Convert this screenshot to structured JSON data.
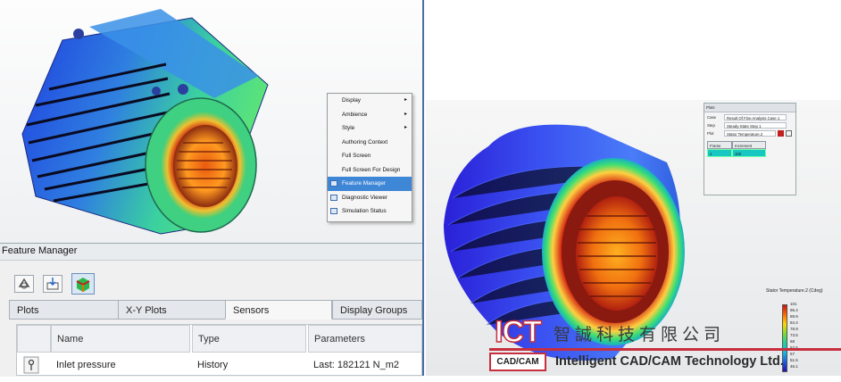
{
  "context_menu": {
    "items": [
      {
        "label": "Display",
        "submenu": true
      },
      {
        "label": "Ambience",
        "submenu": true
      },
      {
        "label": "Style",
        "submenu": true
      },
      {
        "label": "Authoring Context",
        "submenu": false
      },
      {
        "label": "Full Screen",
        "submenu": false
      },
      {
        "label": "Full Screen For Design",
        "submenu": false
      },
      {
        "label": "Feature Manager",
        "submenu": false,
        "selected": true
      },
      {
        "label": "Diagnostic Viewer",
        "submenu": false
      },
      {
        "label": "Simulation Status",
        "submenu": false
      }
    ],
    "submenu_arrow": "▸"
  },
  "feature_manager": {
    "title": "Feature Manager",
    "tabs": [
      {
        "label": "Plots"
      },
      {
        "label": "X-Y Plots"
      },
      {
        "label": "Sensors",
        "active": true
      },
      {
        "label": "Display Groups"
      }
    ],
    "columns": [
      "Name",
      "Type",
      "Parameters"
    ],
    "rows": [
      {
        "name": "Inlet pressure",
        "type": "History",
        "parameters": "Last: 182121 N_m2"
      }
    ]
  },
  "plots_dialog": {
    "title": "Plots",
    "fields": [
      {
        "label": "Case",
        "value": "Result Of Fine Analysis Case 1"
      },
      {
        "label": "Step",
        "value": "Steady-State Step 1"
      },
      {
        "label": "Plot",
        "value": "Stator Temperature.2"
      }
    ],
    "table_headers": [
      "Frame",
      "Increment"
    ],
    "table_row": [
      "1",
      "100"
    ]
  },
  "legend": {
    "title": "Stator Temperature.2 (Cdeg)",
    "ticks": [
      "101",
      "95.4",
      "89.9",
      "84.4",
      "78.9",
      "73.5",
      "68",
      "62.5",
      "57",
      "51.5",
      "46.1"
    ]
  },
  "logo": {
    "letters": "ICT",
    "tag": "CAD/CAM",
    "chinese_name": "智誠科技有限公司",
    "english_name": "Intelligent CAD/CAM Technology Ltd."
  },
  "colors": {
    "accent_blue": "#3e86d6",
    "brand_red": "#c62f3e",
    "cyan_cell": "#18c7c2"
  }
}
